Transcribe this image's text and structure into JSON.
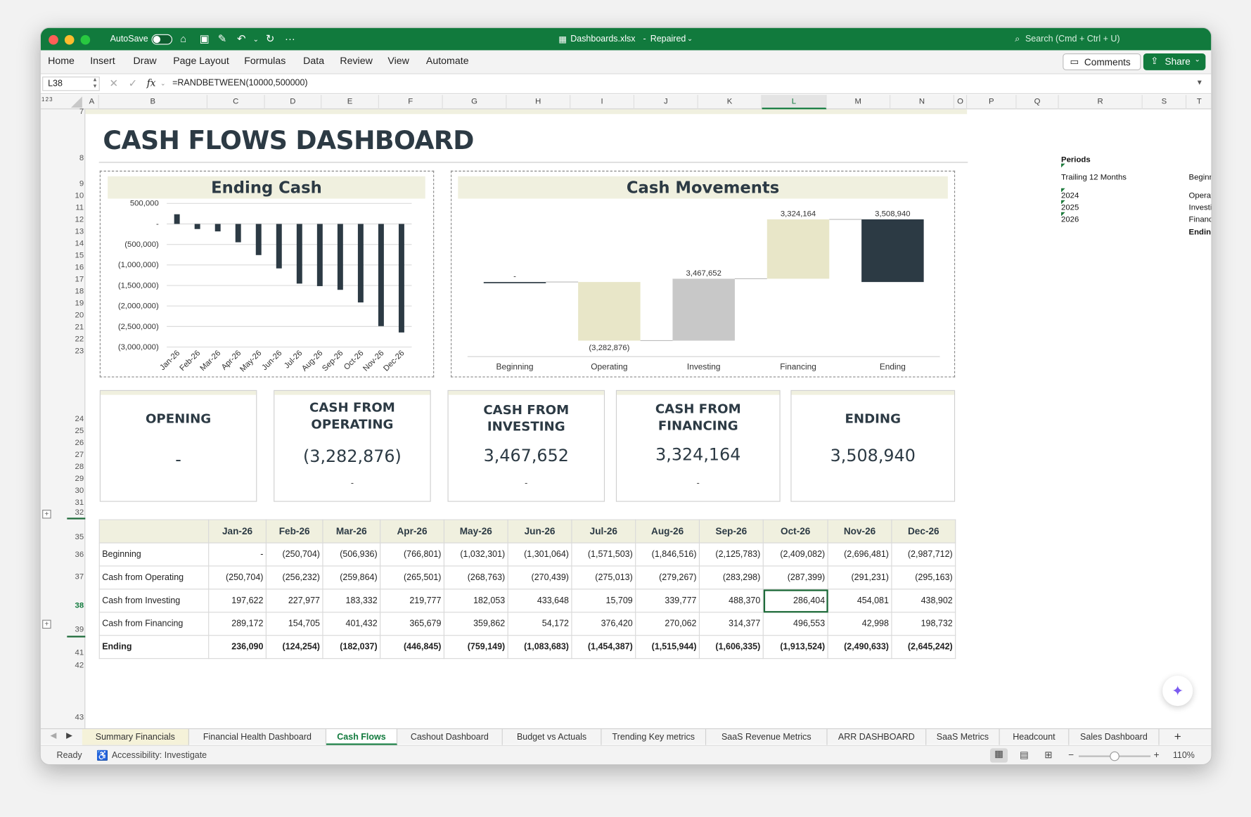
{
  "window": {
    "filename": "Dashboards.xlsx",
    "status": "Repaired",
    "autosave_label": "AutoSave",
    "search_placeholder": "Search (Cmd + Ctrl + U)"
  },
  "ribbon": {
    "menus": [
      "Home",
      "Insert",
      "Draw",
      "Page Layout",
      "Formulas",
      "Data",
      "Review",
      "View",
      "Automate"
    ],
    "comments_label": "Comments",
    "share_label": "Share"
  },
  "formula_bar": {
    "cell": "L38",
    "formula": "=RANDBETWEEN(10000,500000)"
  },
  "columns": [
    "A",
    "B",
    "C",
    "D",
    "E",
    "F",
    "G",
    "H",
    "I",
    "J",
    "K",
    "L",
    "M",
    "N",
    "O",
    "P",
    "Q",
    "R",
    "S",
    "T"
  ],
  "outline_levels": [
    "1",
    "2",
    "3"
  ],
  "rows": [
    "7",
    "8",
    "9",
    "10",
    "11",
    "12",
    "13",
    "14",
    "15",
    "16",
    "17",
    "18",
    "19",
    "20",
    "21",
    "22",
    "23",
    "24",
    "25",
    "26",
    "27",
    "28",
    "29",
    "30",
    "31",
    "32",
    "35",
    "36",
    "37",
    "38",
    "39",
    "41",
    "42",
    "43"
  ],
  "dashboard": {
    "title": "CASH FLOWS DASHBOARD"
  },
  "chart_data": [
    {
      "type": "bar",
      "title": "Ending Cash",
      "categories": [
        "Jan-26",
        "Feb-26",
        "Mar-26",
        "Apr-26",
        "May-26",
        "Jun-26",
        "Jul-26",
        "Aug-26",
        "Sep-26",
        "Oct-26",
        "Nov-26",
        "Dec-26"
      ],
      "values": [
        236090,
        -124254,
        -182037,
        -446845,
        -759149,
        -1083683,
        -1454387,
        -1515944,
        -1606335,
        -1913524,
        -2490633,
        -2645242
      ],
      "yticks": [
        "500,000",
        "-",
        "(500,000)",
        "(1,000,000)",
        "(1,500,000)",
        "(2,000,000)",
        "(2,500,000)",
        "(3,000,000)"
      ],
      "ylim": [
        -3000000,
        500000
      ],
      "color": "#2c3a44",
      "grid": true
    },
    {
      "type": "bar",
      "subtype": "waterfall",
      "title": "Cash Movements",
      "categories": [
        "Beginning",
        "Operating",
        "Investing",
        "Financing",
        "Ending"
      ],
      "values": [
        0,
        -3282876,
        3467652,
        3324164,
        3508940
      ],
      "labels": [
        "-",
        "(3,282,876)",
        "3,467,652",
        "3,324,164",
        "3,508,940"
      ],
      "colors": [
        "#2c3a44",
        "#e8e6c8",
        "#c8c8c8",
        "#e8e6c8",
        "#2c3a44"
      ]
    }
  ],
  "kpis": [
    {
      "label1": "OPENING",
      "label2": "",
      "value": "-",
      "sub": ""
    },
    {
      "label1": "CASH FROM",
      "label2": "OPERATING",
      "value": "(3,282,876)",
      "sub": "-"
    },
    {
      "label1": "CASH FROM",
      "label2": "INVESTING",
      "value": "3,467,652",
      "sub": "-"
    },
    {
      "label1": "CASH FROM",
      "label2": "FINANCING",
      "value": "3,324,164",
      "sub": "-"
    },
    {
      "label1": "ENDING",
      "label2": "",
      "value": "3,508,940",
      "sub": ""
    }
  ],
  "table": {
    "headers": [
      "",
      "Jan-26",
      "Feb-26",
      "Mar-26",
      "Apr-26",
      "May-26",
      "Jun-26",
      "Jul-26",
      "Aug-26",
      "Sep-26",
      "Oct-26",
      "Nov-26",
      "Dec-26"
    ],
    "rows": [
      [
        "Beginning",
        "-",
        "(250,704)",
        "(506,936)",
        "(766,801)",
        "(1,032,301)",
        "(1,301,064)",
        "(1,571,503)",
        "(1,846,516)",
        "(2,125,783)",
        "(2,409,082)",
        "(2,696,481)",
        "(2,987,712)"
      ],
      [
        "Cash from Operating",
        "(250,704)",
        "(256,232)",
        "(259,864)",
        "(265,501)",
        "(268,763)",
        "(270,439)",
        "(275,013)",
        "(279,267)",
        "(283,298)",
        "(287,399)",
        "(291,231)",
        "(295,163)"
      ],
      [
        "Cash from Investing",
        "197,622",
        "227,977",
        "183,332",
        "219,777",
        "182,053",
        "433,648",
        "15,709",
        "339,777",
        "488,370",
        "286,404",
        "454,081",
        "438,902"
      ],
      [
        "Cash from Financing",
        "289,172",
        "154,705",
        "401,432",
        "365,679",
        "359,862",
        "54,172",
        "376,420",
        "270,062",
        "314,377",
        "496,553",
        "42,998",
        "198,732"
      ],
      [
        "Ending",
        "236,090",
        "(124,254)",
        "(182,037)",
        "(446,845)",
        "(759,149)",
        "(1,083,683)",
        "(1,454,387)",
        "(1,515,944)",
        "(1,606,335)",
        "(1,913,524)",
        "(2,490,633)",
        "(2,645,242)"
      ]
    ]
  },
  "periods": {
    "title": "Periods",
    "trailing": "Trailing 12 Months",
    "years": [
      "2024",
      "2025",
      "2026"
    ],
    "side_labels": [
      "Beginn",
      "Operat",
      "Investi",
      "Financ",
      "Ending"
    ]
  },
  "sheet_tabs": [
    "Summary Financials",
    "Financial Health Dashboard",
    "Cash Flows",
    "Cashout Dashboard",
    "Budget vs Actuals",
    "Trending Key metrics",
    "SaaS Revenue Metrics",
    "ARR DASHBOARD",
    "SaaS Metrics",
    "Headcount",
    "Sales Dashboard"
  ],
  "active_tab": "Cash Flows",
  "status": {
    "ready": "Ready",
    "accessibility": "Accessibility: Investigate",
    "zoom": "110%"
  }
}
